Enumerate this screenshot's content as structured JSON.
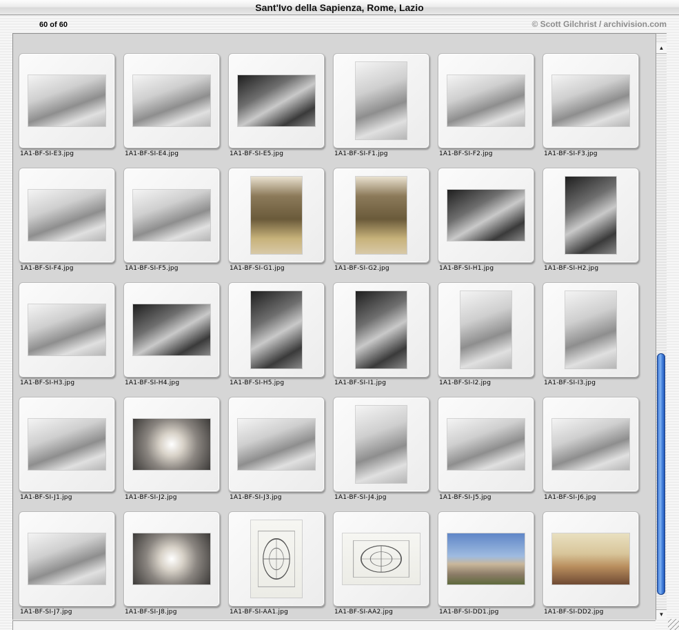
{
  "window": {
    "title": "Sant'Ivo della Sapienza, Rome, Lazio",
    "counter": "60 of 60",
    "credit": "© Scott Gilchrist / archivision.com"
  },
  "scrollbar": {
    "up_glyph": "▲",
    "down_glyph": "▼",
    "position_fraction": 0.95
  },
  "thumbnails": [
    {
      "name": "1A1-BF-SI-E3.jpg",
      "orientation": "land",
      "tone": "arch"
    },
    {
      "name": "1A1-BF-SI-E4.jpg",
      "orientation": "land",
      "tone": "arch"
    },
    {
      "name": "1A1-BF-SI-E5.jpg",
      "orientation": "land",
      "tone": "dark"
    },
    {
      "name": "1A1-BF-SI-F1.jpg",
      "orientation": "port",
      "tone": "arch"
    },
    {
      "name": "1A1-BF-SI-F2.jpg",
      "orientation": "land",
      "tone": "arch"
    },
    {
      "name": "1A1-BF-SI-F3.jpg",
      "orientation": "land",
      "tone": "arch"
    },
    {
      "name": "1A1-BF-SI-F4.jpg",
      "orientation": "land",
      "tone": "arch"
    },
    {
      "name": "1A1-BF-SI-F5.jpg",
      "orientation": "land",
      "tone": "arch"
    },
    {
      "name": "1A1-BF-SI-G1.jpg",
      "orientation": "port",
      "tone": "altar"
    },
    {
      "name": "1A1-BF-SI-G2.jpg",
      "orientation": "port",
      "tone": "altar"
    },
    {
      "name": "1A1-BF-SI-H1.jpg",
      "orientation": "land",
      "tone": "dark"
    },
    {
      "name": "1A1-BF-SI-H2.jpg",
      "orientation": "port",
      "tone": "dark"
    },
    {
      "name": "1A1-BF-SI-H3.jpg",
      "orientation": "land",
      "tone": "arch"
    },
    {
      "name": "1A1-BF-SI-H4.jpg",
      "orientation": "land",
      "tone": "dark"
    },
    {
      "name": "1A1-BF-SI-H5.jpg",
      "orientation": "port",
      "tone": "dark"
    },
    {
      "name": "1A1-BF-SI-I1.jpg",
      "orientation": "port",
      "tone": "dark"
    },
    {
      "name": "1A1-BF-SI-I2.jpg",
      "orientation": "port",
      "tone": "arch"
    },
    {
      "name": "1A1-BF-SI-I3.jpg",
      "orientation": "port",
      "tone": "arch"
    },
    {
      "name": "1A1-BF-SI-J1.jpg",
      "orientation": "land",
      "tone": "arch"
    },
    {
      "name": "1A1-BF-SI-J2.jpg",
      "orientation": "land",
      "tone": "dome"
    },
    {
      "name": "1A1-BF-SI-J3.jpg",
      "orientation": "land",
      "tone": "arch"
    },
    {
      "name": "1A1-BF-SI-J4.jpg",
      "orientation": "port",
      "tone": "arch"
    },
    {
      "name": "1A1-BF-SI-J5.jpg",
      "orientation": "land",
      "tone": "arch"
    },
    {
      "name": "1A1-BF-SI-J6.jpg",
      "orientation": "land",
      "tone": "arch"
    },
    {
      "name": "1A1-BF-SI-J7.jpg",
      "orientation": "land",
      "tone": "arch"
    },
    {
      "name": "1A1-BF-SI-J8.jpg",
      "orientation": "land",
      "tone": "dome"
    },
    {
      "name": "1A1-BF-SI-AA1.jpg",
      "orientation": "port",
      "tone": "plan"
    },
    {
      "name": "1A1-BF-SI-AA2.jpg",
      "orientation": "land",
      "tone": "plan"
    },
    {
      "name": "1A1-BF-SI-DD1.jpg",
      "orientation": "land",
      "tone": "city"
    },
    {
      "name": "1A1-BF-SI-DD2.jpg",
      "orientation": "land",
      "tone": "sunset"
    }
  ]
}
